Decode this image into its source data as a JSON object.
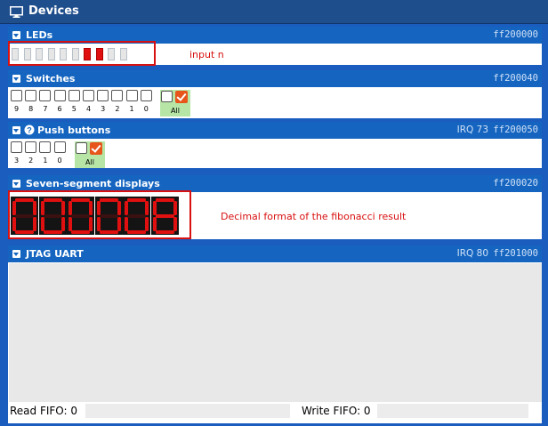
{
  "window": {
    "title": "Devices",
    "icon": "monitor-icon"
  },
  "leds": {
    "title": "LEDs",
    "address": "ff200000",
    "count": 10,
    "on": [
      6,
      7
    ],
    "annotation": "input n"
  },
  "switches": {
    "title": "Switches",
    "address": "ff200040",
    "labels": [
      "9",
      "8",
      "7",
      "6",
      "5",
      "4",
      "3",
      "2",
      "1",
      "0"
    ],
    "all_label": "All"
  },
  "push_buttons": {
    "title": "Push buttons",
    "irq": "IRQ 73",
    "address": "ff200050",
    "labels": [
      "3",
      "2",
      "1",
      "0"
    ],
    "all_label": "All",
    "help_icon": "question-circle-icon"
  },
  "seven_segment": {
    "title": "Seven-segment displays",
    "address": "ff200020",
    "digits": [
      "0",
      "0",
      "0",
      "0",
      "0",
      "8"
    ],
    "annotation": "Decimal format of the fibonacci result"
  },
  "jtag_uart": {
    "title": "JTAG UART",
    "irq": "IRQ 80",
    "address": "ff201000",
    "read_fifo": "Read FIFO: 0",
    "write_fifo": "Write FIFO: 0"
  },
  "colors": {
    "header_blue": "#1565c0",
    "led_on": "#e01010",
    "annotation_red": "#d81010",
    "check_orange": "#e8551b",
    "all_green": "#b6e5a6"
  }
}
